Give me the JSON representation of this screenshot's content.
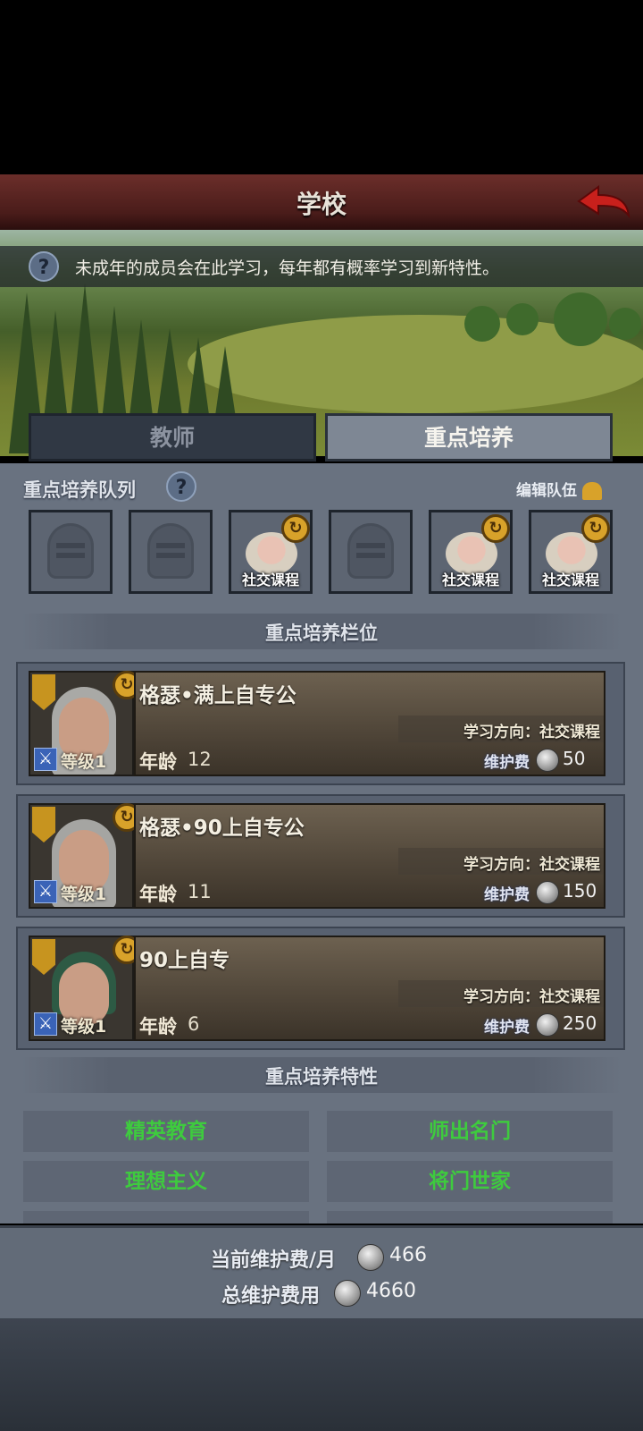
{
  "header": {
    "title": "学校"
  },
  "hint": {
    "text": "未成年的成员会在此学习，每年都有概率学习到新特性。",
    "icon": "question-icon"
  },
  "tabs": [
    {
      "label": "教师",
      "active": false
    },
    {
      "label": "重点培养",
      "active": true
    }
  ],
  "queue": {
    "title": "重点培养队列",
    "edit_label": "编辑队伍",
    "slots": [
      {
        "state": "empty",
        "label": ""
      },
      {
        "state": "empty",
        "label": ""
      },
      {
        "state": "filled",
        "label": "社交课程"
      },
      {
        "state": "empty",
        "label": ""
      },
      {
        "state": "filled",
        "label": "社交课程"
      },
      {
        "state": "filled",
        "label": "社交课程"
      }
    ]
  },
  "slots_section": {
    "title": "重点培养栏位"
  },
  "members": [
    {
      "name": "格瑟•满上自专公",
      "level": "等级1",
      "age_label": "年龄",
      "age": "12",
      "direction": "学习方向：社交课程",
      "fee_label": "维护费",
      "fee": "50"
    },
    {
      "name": "格瑟•90上自专公",
      "level": "等级1",
      "age_label": "年龄",
      "age": "11",
      "direction": "学习方向：社交课程",
      "fee_label": "维护费",
      "fee": "150"
    },
    {
      "name": "90上自专",
      "level": "等级1",
      "age_label": "年龄",
      "age": "6",
      "direction": "学习方向：社交课程",
      "fee_label": "维护费",
      "fee": "250"
    }
  ],
  "traits_section": {
    "title": "重点培养特性"
  },
  "traits": [
    "精英教育",
    "师出名门",
    "理想主义",
    "将门世家"
  ],
  "summary": {
    "monthly_label": "当前维护费/月",
    "monthly_value": "466",
    "total_label": "总维护费用",
    "total_value": "4660"
  },
  "colors": {
    "trait_text": "#3ecb3e",
    "header_bg": "#5a2422",
    "back_arrow": "#c8201c"
  }
}
